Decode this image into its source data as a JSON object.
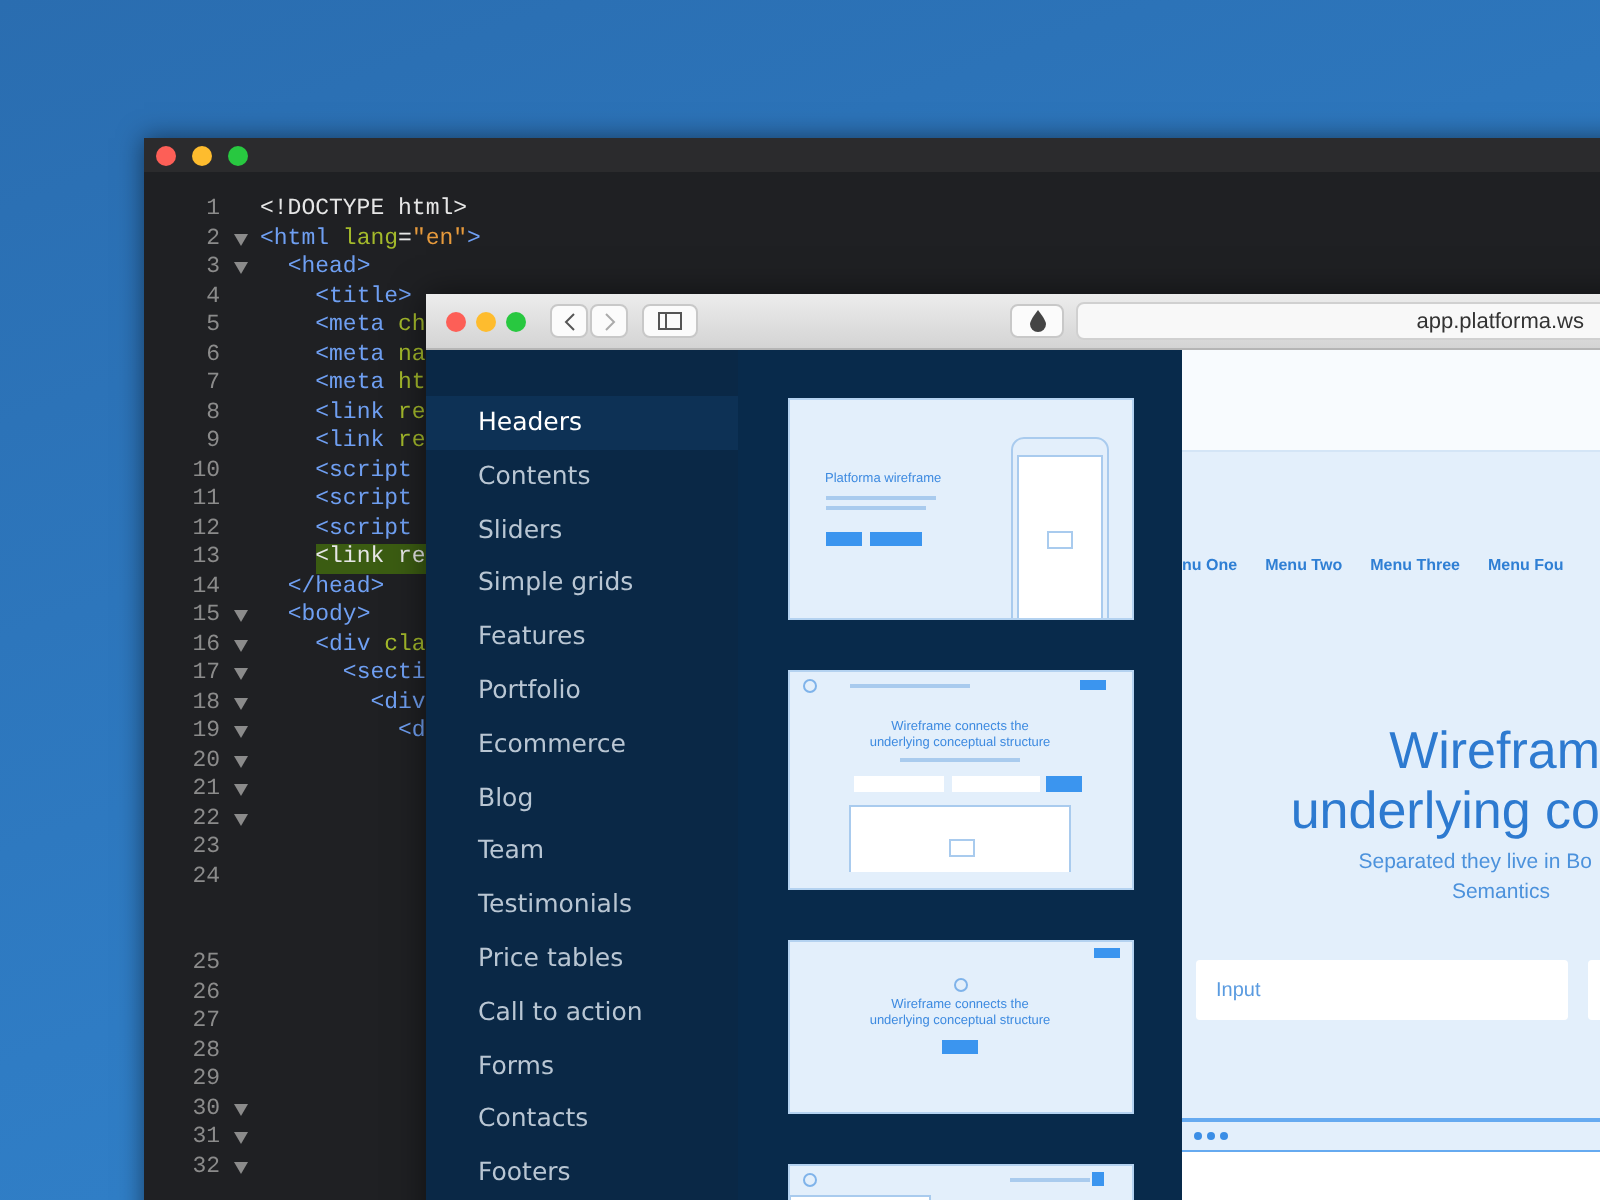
{
  "editor": {
    "lines": [
      {
        "number": "1",
        "fold": false,
        "kind": "line",
        "highlighted": false,
        "tokens": [
          {
            "kind": "plain",
            "text": "<!DOCTYPE html>"
          }
        ]
      },
      {
        "number": "2",
        "fold": true,
        "kind": "line",
        "highlighted": false,
        "tokens": [
          {
            "kind": "tag",
            "text": "<html"
          },
          {
            "kind": "attr",
            "text": " lang"
          },
          {
            "kind": "plain",
            "text": "="
          },
          {
            "kind": "value",
            "text": "\"en\""
          },
          {
            "kind": "tag",
            "text": ">"
          }
        ]
      },
      {
        "number": "3",
        "fold": true,
        "kind": "line",
        "highlighted": false,
        "tokens": [
          {
            "kind": "tag",
            "text": "  <head>"
          }
        ]
      },
      {
        "number": "4",
        "fold": false,
        "kind": "line",
        "highlighted": false,
        "tokens": [
          {
            "kind": "tag",
            "text": "    <title>"
          }
        ]
      },
      {
        "number": "5",
        "fold": false,
        "kind": "line",
        "highlighted": false,
        "tokens": [
          {
            "kind": "tag",
            "text": "    <meta"
          },
          {
            "kind": "attr",
            "text": " ch"
          }
        ]
      },
      {
        "number": "6",
        "fold": false,
        "kind": "line",
        "highlighted": false,
        "tokens": [
          {
            "kind": "tag",
            "text": "    <meta"
          },
          {
            "kind": "attr",
            "text": " na"
          }
        ]
      },
      {
        "number": "7",
        "fold": false,
        "kind": "line",
        "highlighted": false,
        "tokens": [
          {
            "kind": "tag",
            "text": "    <meta"
          },
          {
            "kind": "attr",
            "text": " ht"
          }
        ]
      },
      {
        "number": "8",
        "fold": false,
        "kind": "line",
        "highlighted": false,
        "tokens": [
          {
            "kind": "tag",
            "text": "    <link"
          },
          {
            "kind": "attr",
            "text": " re"
          }
        ]
      },
      {
        "number": "9",
        "fold": false,
        "kind": "line",
        "highlighted": false,
        "tokens": [
          {
            "kind": "tag",
            "text": "    <link"
          },
          {
            "kind": "attr",
            "text": " re"
          }
        ]
      },
      {
        "number": "10",
        "fold": false,
        "kind": "line",
        "highlighted": false,
        "tokens": [
          {
            "kind": "tag",
            "text": "    <script"
          }
        ]
      },
      {
        "number": "11",
        "fold": false,
        "kind": "line",
        "highlighted": false,
        "tokens": [
          {
            "kind": "tag",
            "text": "    <script"
          }
        ]
      },
      {
        "number": "12",
        "fold": false,
        "kind": "line",
        "highlighted": false,
        "tokens": [
          {
            "kind": "tag",
            "text": "    <script"
          }
        ]
      },
      {
        "number": "13",
        "fold": false,
        "kind": "line",
        "highlighted": true,
        "tokens": [
          {
            "kind": "plain",
            "text": "    <link re"
          }
        ]
      },
      {
        "number": "14",
        "fold": false,
        "kind": "line",
        "highlighted": false,
        "tokens": [
          {
            "kind": "tag",
            "text": "  </head>"
          }
        ]
      },
      {
        "number": "15",
        "fold": true,
        "kind": "line",
        "highlighted": false,
        "tokens": [
          {
            "kind": "tag",
            "text": "  <body>"
          }
        ]
      },
      {
        "number": "16",
        "fold": true,
        "kind": "line",
        "highlighted": false,
        "tokens": [
          {
            "kind": "tag",
            "text": "    <div"
          },
          {
            "kind": "attr",
            "text": " cla"
          }
        ]
      },
      {
        "number": "17",
        "fold": true,
        "kind": "line",
        "highlighted": false,
        "tokens": [
          {
            "kind": "tag",
            "text": "      <secti"
          }
        ]
      },
      {
        "number": "18",
        "fold": true,
        "kind": "line",
        "highlighted": false,
        "tokens": [
          {
            "kind": "tag",
            "text": "        <div"
          }
        ]
      },
      {
        "number": "19",
        "fold": true,
        "kind": "line",
        "highlighted": false,
        "tokens": [
          {
            "kind": "tag",
            "text": "          <d"
          }
        ]
      },
      {
        "number": "20",
        "fold": true,
        "kind": "line"
      },
      {
        "number": "21",
        "fold": true,
        "kind": "line"
      },
      {
        "number": "22",
        "fold": true,
        "kind": "line"
      },
      {
        "number": "23",
        "fold": false,
        "kind": "line"
      },
      {
        "number": "24",
        "fold": false,
        "kind": "wrapped"
      },
      {
        "number": "25",
        "fold": false,
        "kind": "line"
      },
      {
        "number": "26",
        "fold": false,
        "kind": "line"
      },
      {
        "number": "27",
        "fold": false,
        "kind": "line"
      },
      {
        "number": "28",
        "fold": false,
        "kind": "line"
      },
      {
        "number": "29",
        "fold": false,
        "kind": "line"
      },
      {
        "number": "30",
        "fold": true,
        "kind": "line"
      },
      {
        "number": "31",
        "fold": true,
        "kind": "line"
      },
      {
        "number": "32",
        "fold": true,
        "kind": "line"
      }
    ]
  },
  "browser": {
    "address": "app.platforma.ws",
    "sidebar": [
      {
        "label": "Headers",
        "selected": true
      },
      {
        "label": "Contents",
        "selected": false
      },
      {
        "label": "Sliders",
        "selected": false
      },
      {
        "label": "Simple grids",
        "selected": false
      },
      {
        "label": "Features",
        "selected": false
      },
      {
        "label": "Portfolio",
        "selected": false
      },
      {
        "label": "Ecommerce",
        "selected": false
      },
      {
        "label": "Blog",
        "selected": false
      },
      {
        "label": "Team",
        "selected": false
      },
      {
        "label": "Testimonials",
        "selected": false
      },
      {
        "label": "Price tables",
        "selected": false
      },
      {
        "label": "Call to action",
        "selected": false
      },
      {
        "label": "Forms",
        "selected": false
      },
      {
        "label": "Contacts",
        "selected": false
      },
      {
        "label": "Footers",
        "selected": false
      }
    ],
    "thumbnails": [
      {
        "kind": "phone",
        "heading": "Platforma wireframe"
      },
      {
        "kind": "form",
        "heading": "Wireframe connects the underlying conceptual structure"
      },
      {
        "kind": "cta",
        "heading": "Wireframe connects the underlying conceptual structure"
      },
      {
        "kind": "split"
      }
    ],
    "preview": {
      "menu": [
        "nu One",
        "Menu Two",
        "Menu Three",
        "Menu Fou"
      ],
      "heading": [
        "Wirefram",
        "underlying co"
      ],
      "subtitle": [
        "Separated they live in Bo",
        "Semantics"
      ],
      "input_placeholder": "Input"
    }
  }
}
